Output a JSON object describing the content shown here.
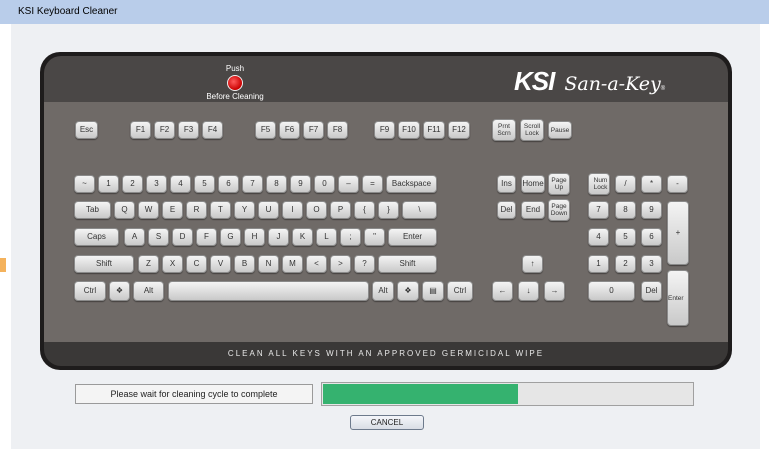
{
  "window": {
    "title": "KSI Keyboard Cleaner"
  },
  "keyboard": {
    "push_label": "Push",
    "push_caption": "Before Cleaning",
    "logo_ksi": "KSI",
    "logo_product": "San-a-Key",
    "logo_mark": "®",
    "footer": "CLEAN ALL KEYS WITH AN APPROVED GERMICIDAL WIPE",
    "keys": {
      "esc": "Esc",
      "f1": "F1",
      "f2": "F2",
      "f3": "F3",
      "f4": "F4",
      "f5": "F5",
      "f6": "F6",
      "f7": "F7",
      "f8": "F8",
      "f9": "F9",
      "f10": "F10",
      "f11": "F11",
      "f12": "F12",
      "prtscrn": "Prnt Scrn",
      "scrolllock": "Scroll Lock",
      "pause": "Pause",
      "tilde": "~",
      "n1": "1",
      "n2": "2",
      "n3": "3",
      "n4": "4",
      "n5": "5",
      "n6": "6",
      "n7": "7",
      "n8": "8",
      "n9": "9",
      "n0": "0",
      "minus": "–",
      "equals": "=",
      "backspace": "Backspace",
      "ins": "Ins",
      "home": "Home",
      "pageup": "Page Up",
      "numlock": "Num Lock",
      "numslash": "/",
      "numstar": "*",
      "numminus": "-",
      "tab": "Tab",
      "q": "Q",
      "w": "W",
      "e": "E",
      "r": "R",
      "t": "T",
      "y": "Y",
      "u": "U",
      "i": "I",
      "o": "O",
      "p": "P",
      "lbracket": "{",
      "rbracket": "}",
      "backslash": "\\",
      "del": "Del",
      "end": "End",
      "pagedown": "Page Down",
      "num7": "7",
      "num8": "8",
      "num9": "9",
      "numplus": "+",
      "caps": "Caps",
      "a": "A",
      "s": "S",
      "d": "D",
      "f": "F",
      "g": "G",
      "h": "H",
      "j": "J",
      "k": "K",
      "l": "L",
      "semicolon": ";",
      "quote": "\"",
      "enter": "Enter",
      "num4": "4",
      "num5": "5",
      "num6": "6",
      "lshift": "Shift",
      "z": "Z",
      "x": "X",
      "c": "C",
      "v": "V",
      "b": "B",
      "n": "N",
      "m": "M",
      "lt": "<",
      "gt": ">",
      "question": "?",
      "rshift": "Shift",
      "up": "↑",
      "num1": "1",
      "num2": "2",
      "num3": "3",
      "numenter": "Enter",
      "lctrl": "Ctrl",
      "lwin": "❖",
      "lalt": "Alt",
      "space": "",
      "ralt": "Alt",
      "rwin": "❖",
      "menu": "▤",
      "rctrl": "Ctrl",
      "left": "←",
      "down": "↓",
      "right": "→",
      "num0": "0",
      "numdel": "Del"
    }
  },
  "status_text": "Please wait for cleaning cycle to complete",
  "progress_fraction": 0.53,
  "cancel_label": "CANCEL"
}
